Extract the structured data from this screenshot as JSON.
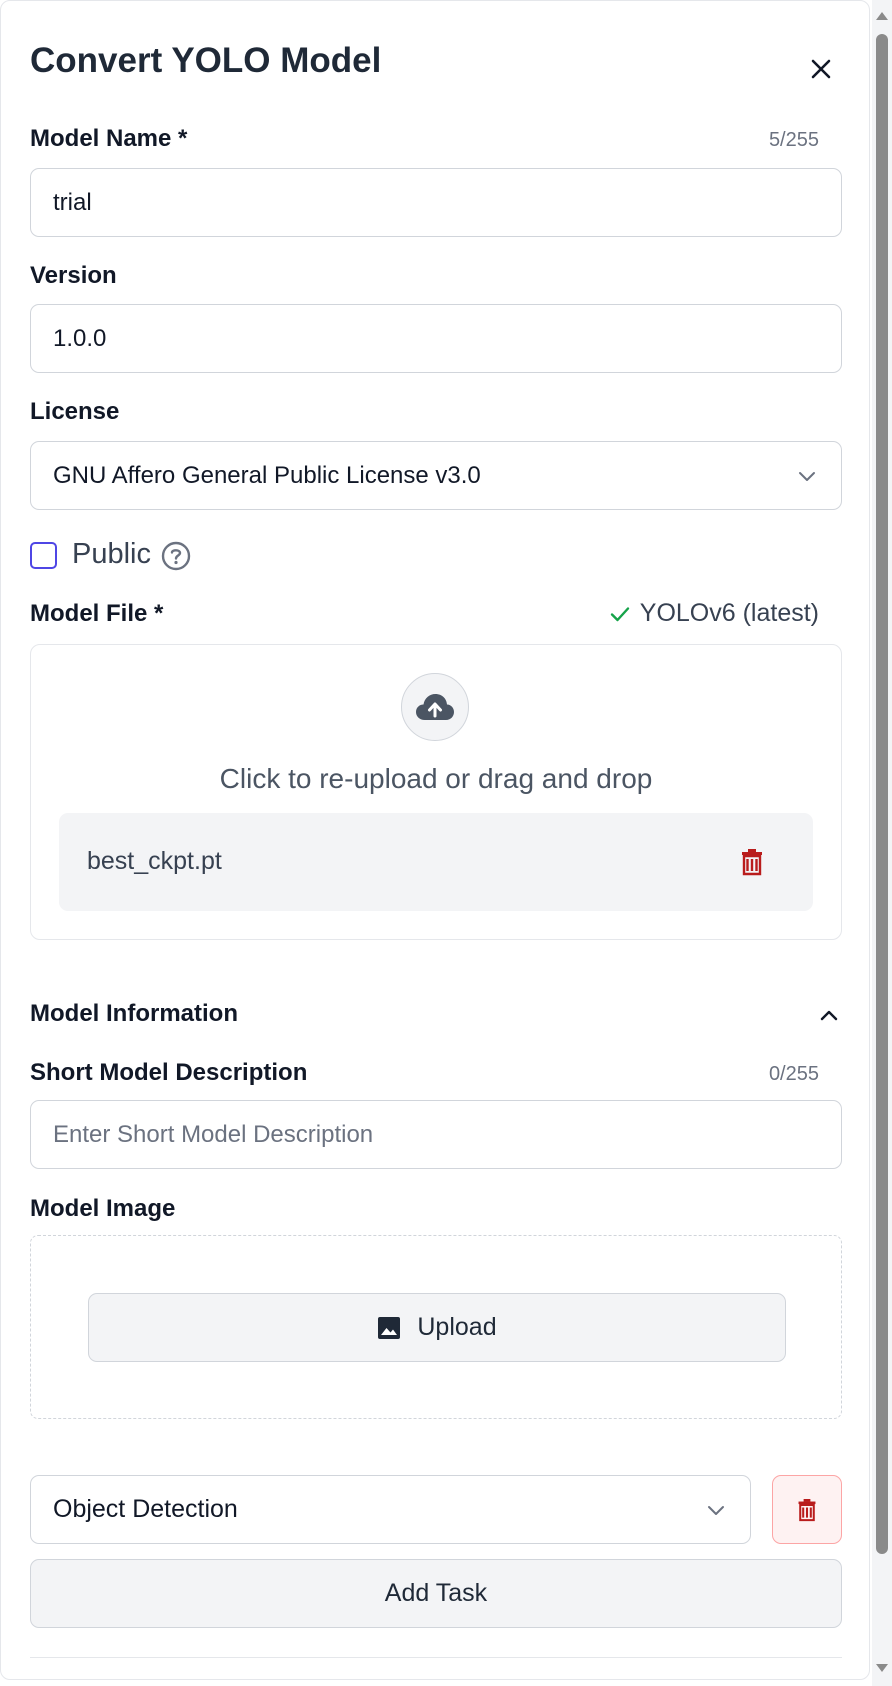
{
  "dialog": {
    "title": "Convert YOLO Model"
  },
  "model_name": {
    "label": "Model Name *",
    "counter": "5/255",
    "value": "trial"
  },
  "version": {
    "label": "Version",
    "value": "1.0.0"
  },
  "license": {
    "label": "License",
    "selected": "GNU Affero General Public License v3.0"
  },
  "public": {
    "label": "Public",
    "checked": false
  },
  "model_file": {
    "label": "Model File *",
    "status": "YOLOv6 (latest)",
    "drop_text": "Click to re-upload or drag and drop",
    "file_name": "best_ckpt.pt"
  },
  "model_information": {
    "title": "Model Information",
    "short_description": {
      "label": "Short Model Description",
      "counter": "0/255",
      "placeholder": "Enter Short Model Description",
      "value": ""
    },
    "model_image": {
      "label": "Model Image",
      "upload_label": "Upload"
    }
  },
  "task": {
    "selected": "Object Detection",
    "add_label": "Add Task"
  },
  "colors": {
    "accent": "#4f46e5",
    "danger": "#b91c1c",
    "success": "#16a34a",
    "border": "#d1d5db"
  },
  "icons": [
    "close-icon",
    "chevron-down-icon",
    "help-circle-icon",
    "check-icon",
    "cloud-upload-icon",
    "trash-icon",
    "chevron-up-icon",
    "image-icon"
  ]
}
